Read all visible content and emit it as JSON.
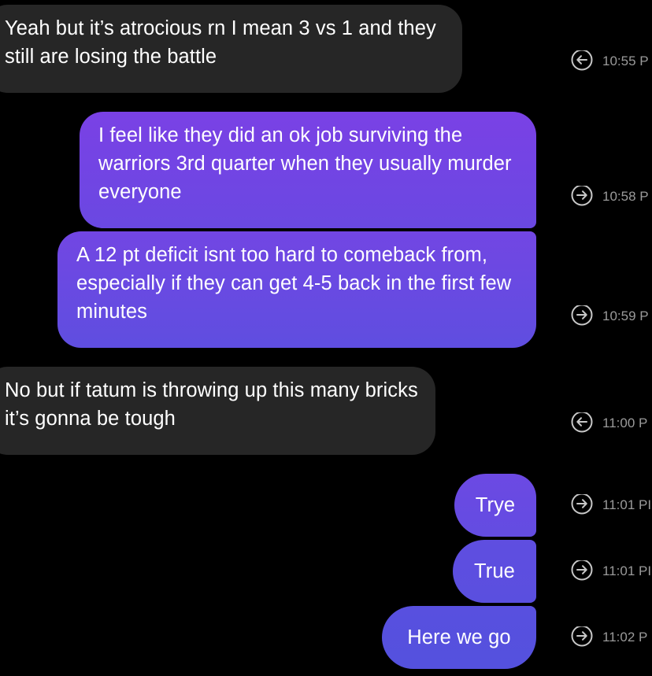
{
  "colors": {
    "background": "#000000",
    "received_bubble": "#262626",
    "sent_gradient_top": "#7b3fe4",
    "sent_gradient_bottom": "#5b4fe0",
    "timestamp": "#9a9a9a"
  },
  "messages": [
    {
      "direction": "received",
      "text": "Yeah but it’s atrocious rn I mean 3 vs 1 and they still are losing the battle",
      "timestamp": "10:55 P",
      "status_icon": "arrow-left-circle-icon"
    },
    {
      "direction": "sent",
      "text": "I feel like they did an ok job surviving the warriors 3rd quarter when they usually murder everyone",
      "timestamp": "10:58 P",
      "status_icon": "arrow-right-circle-icon"
    },
    {
      "direction": "sent",
      "text": "A 12 pt deficit isnt too hard to comeback from, especially if they can get 4-5 back in the first few minutes",
      "timestamp": "10:59 P",
      "status_icon": "arrow-right-circle-icon"
    },
    {
      "direction": "received",
      "text": "No but if tatum is throwing up this many bricks it’s gonna be tough",
      "timestamp": "11:00 P",
      "status_icon": "arrow-left-circle-icon"
    },
    {
      "direction": "sent",
      "text": "Trye",
      "timestamp": "11:01 PI",
      "status_icon": "arrow-right-circle-icon"
    },
    {
      "direction": "sent",
      "text": "True",
      "timestamp": "11:01 PI",
      "status_icon": "arrow-right-circle-icon"
    },
    {
      "direction": "sent",
      "text": "Here we go",
      "timestamp": "11:02 P",
      "status_icon": "arrow-right-circle-icon"
    }
  ]
}
